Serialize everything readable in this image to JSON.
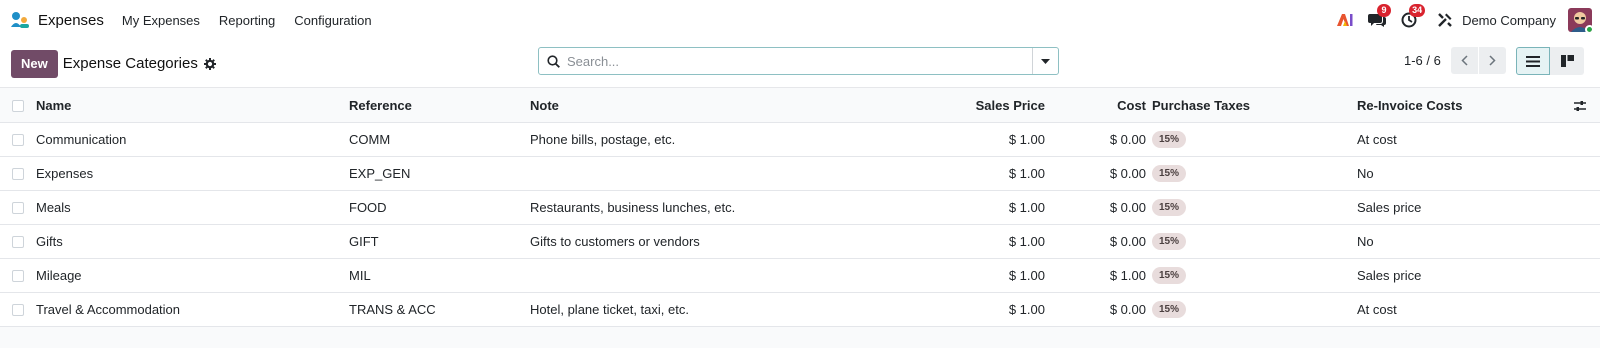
{
  "navbar": {
    "app_name": "Expenses",
    "menu": [
      "My Expenses",
      "Reporting",
      "Configuration"
    ],
    "messages_badge": "9",
    "activities_badge": "34",
    "company": "Demo Company"
  },
  "control": {
    "new_label": "New",
    "title": "Expense Categories",
    "search_placeholder": "Search...",
    "pager": "1-6 / 6"
  },
  "table": {
    "headers": {
      "name": "Name",
      "reference": "Reference",
      "note": "Note",
      "sales_price": "Sales Price",
      "cost": "Cost",
      "purchase_taxes": "Purchase Taxes",
      "reinvoice": "Re-Invoice Costs"
    },
    "rows": [
      {
        "name": "Communication",
        "reference": "COMM",
        "note": "Phone bills, postage, etc.",
        "sales_price": "$ 1.00",
        "cost": "$ 0.00",
        "tax": "15%",
        "reinvoice": "At cost"
      },
      {
        "name": "Expenses",
        "reference": "EXP_GEN",
        "note": "",
        "sales_price": "$ 1.00",
        "cost": "$ 0.00",
        "tax": "15%",
        "reinvoice": "No"
      },
      {
        "name": "Meals",
        "reference": "FOOD",
        "note": "Restaurants, business lunches, etc.",
        "sales_price": "$ 1.00",
        "cost": "$ 0.00",
        "tax": "15%",
        "reinvoice": "Sales price"
      },
      {
        "name": "Gifts",
        "reference": "GIFT",
        "note": "Gifts to customers or vendors",
        "sales_price": "$ 1.00",
        "cost": "$ 0.00",
        "tax": "15%",
        "reinvoice": "No"
      },
      {
        "name": "Mileage",
        "reference": "MIL",
        "note": "",
        "sales_price": "$ 1.00",
        "cost": "$ 1.00",
        "tax": "15%",
        "reinvoice": "Sales price"
      },
      {
        "name": "Travel & Accommodation",
        "reference": "TRANS & ACC",
        "note": "Hotel, plane ticket, taxi, etc.",
        "sales_price": "$ 1.00",
        "cost": "$ 0.00",
        "tax": "15%",
        "reinvoice": "At cost"
      }
    ]
  },
  "colors": {
    "primary": "#714b67",
    "badge": "#d9232e",
    "tag": "#e8dcdc"
  }
}
